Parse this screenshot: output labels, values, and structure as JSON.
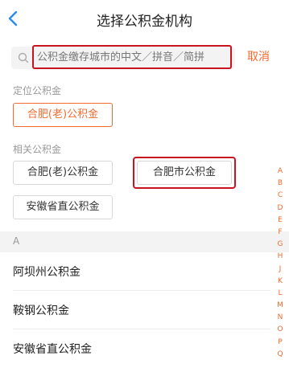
{
  "header": {
    "title": "选择公积金机构"
  },
  "search": {
    "placeholder": "公积金缴存城市的中文／拼音／简拼",
    "cancel_label": "取消"
  },
  "location": {
    "section_label": "定位公积金",
    "current": "合肥(老)公积金"
  },
  "related": {
    "section_label": "相关公积金",
    "items": [
      "合肥(老)公积金",
      "合肥市公积金",
      "安徽省直公积金"
    ]
  },
  "list": {
    "letter": "A",
    "items": [
      "阿坝州公积金",
      "鞍钢公积金",
      "安徽省直公积金"
    ]
  },
  "index_letters": [
    "A",
    "B",
    "C",
    "D",
    "E",
    "F",
    "G",
    "H",
    "J",
    "K",
    "L",
    "M",
    "N",
    "O",
    "P",
    "Q"
  ],
  "colors": {
    "accent": "#f26a2e",
    "back": "#2a8cf0",
    "highlight": "#c8141e"
  }
}
